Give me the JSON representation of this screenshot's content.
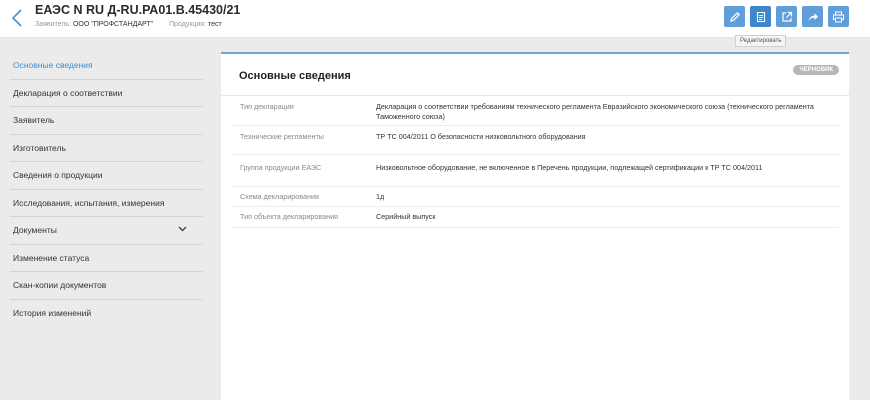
{
  "header": {
    "title": "ЕАЭС N RU Д-RU.РА01.В.45430/21",
    "applicant_label": "Заявитель:",
    "applicant_value": "ООО \"ПРОФСТАНДАРТ\"",
    "product_label": "Продукция:",
    "product_value": "тест"
  },
  "toolbar": {
    "buttons": [
      {
        "icon": "pencil-icon"
      },
      {
        "icon": "document-icon"
      },
      {
        "icon": "external-link-icon"
      },
      {
        "icon": "share-arrow-icon"
      },
      {
        "icon": "printer-icon"
      }
    ],
    "tooltip": "Редактировать"
  },
  "sidebar": {
    "items": [
      {
        "label": "Основные сведения"
      },
      {
        "label": "Декларация о соответствии"
      },
      {
        "label": "Заявитель"
      },
      {
        "label": "Изготовитель"
      },
      {
        "label": "Сведения о продукции"
      },
      {
        "label": "Исследования, испытания, измерения"
      },
      {
        "label": "Документы"
      },
      {
        "label": "Изменение статуса"
      },
      {
        "label": "Скан-копии документов"
      },
      {
        "label": "История изменений"
      }
    ]
  },
  "panel": {
    "title": "Основные сведения",
    "badge": "ЧЕРНОВИК",
    "rows": [
      {
        "key": "Тип декларации",
        "value": "Декларация о соответствии требованиям технического регламента Евразийского экономического союза (технического регламента Таможенного союза)"
      },
      {
        "key": "Технические регламенты",
        "value": "ТР ТС 004/2011 О безопасности низковольтного оборудования"
      },
      {
        "key": "Группа продукции ЕАЭС",
        "value": "Низковольтное оборудование, не включенное в Перечень продукции, подлежащей сертификации к ТР ТС 004/2011"
      },
      {
        "key": "Схема декларирования",
        "value": "1д"
      },
      {
        "key": "Тип объекта декларирования",
        "value": "Серийный выпуск"
      }
    ]
  },
  "colors": {
    "accent": "#3a8fd6",
    "button": "#5f9ed8",
    "badge": "#b7b7b7"
  }
}
